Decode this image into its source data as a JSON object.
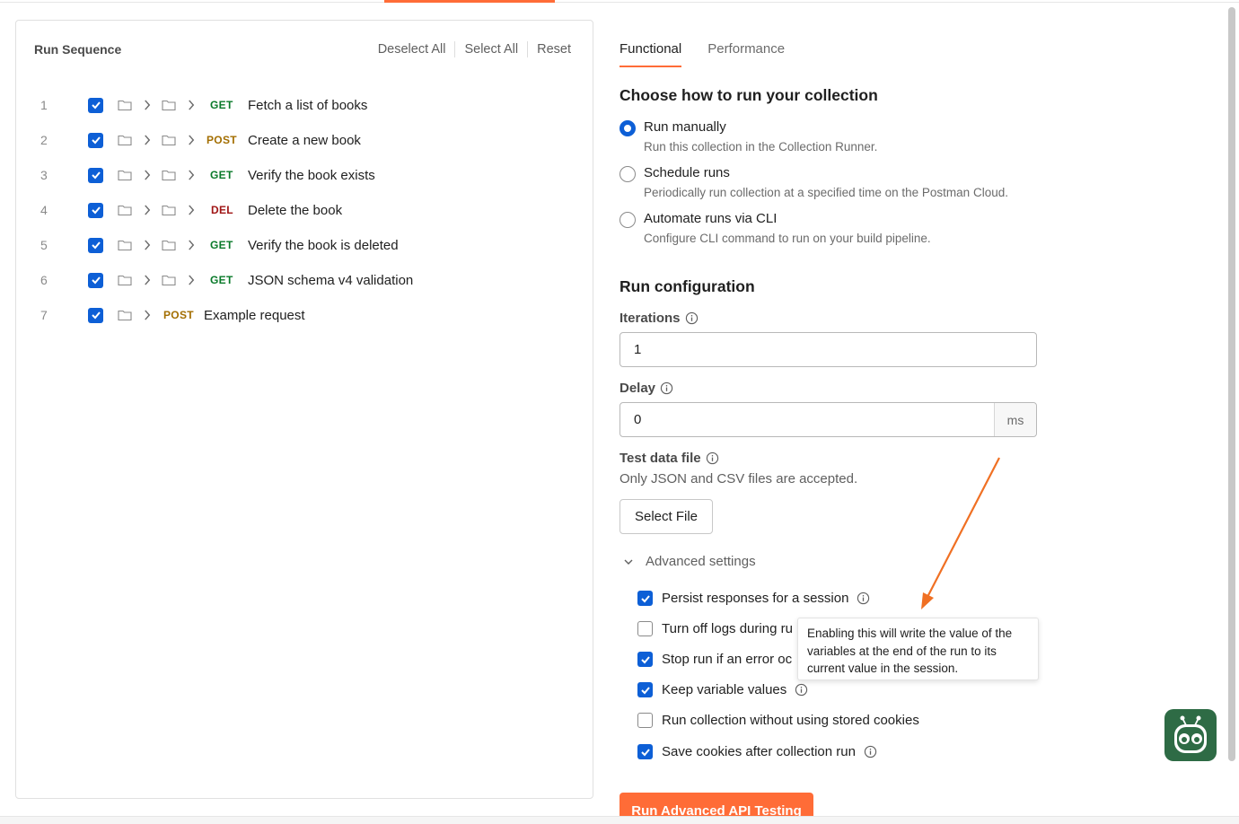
{
  "run_sequence": {
    "title": "Run Sequence",
    "actions": [
      "Deselect All",
      "Select All",
      "Reset"
    ],
    "items": [
      {
        "num": "1",
        "method": "GET",
        "name": "Fetch a list of books",
        "checked": true
      },
      {
        "num": "2",
        "method": "POST",
        "name": "Create a new book",
        "checked": true
      },
      {
        "num": "3",
        "method": "GET",
        "name": "Verify the book exists",
        "checked": true
      },
      {
        "num": "4",
        "method": "DEL",
        "name": "Delete the book",
        "checked": true
      },
      {
        "num": "5",
        "method": "GET",
        "name": "Verify the book is deleted",
        "checked": true
      },
      {
        "num": "6",
        "method": "GET",
        "name": "JSON schema v4 validation",
        "checked": true
      },
      {
        "num": "7",
        "method": "POST",
        "name": "Example request",
        "checked": true
      }
    ]
  },
  "tabs": [
    {
      "label": "Functional",
      "active": true
    },
    {
      "label": "Performance",
      "active": false
    }
  ],
  "run_mode": {
    "heading": "Choose how to run your collection",
    "options": [
      {
        "label": "Run manually",
        "description": "Run this collection in the Collection Runner.",
        "selected": true
      },
      {
        "label": "Schedule runs",
        "description": "Periodically run collection at a specified time on the Postman Cloud.",
        "selected": false
      },
      {
        "label": "Automate runs via CLI",
        "description": "Configure CLI command to run on your build pipeline.",
        "selected": false
      }
    ]
  },
  "config": {
    "heading": "Run configuration",
    "iterations_label": "Iterations",
    "iterations_value": "1",
    "delay_label": "Delay",
    "delay_value": "0",
    "delay_unit": "ms",
    "test_data_label": "Test data file",
    "test_data_hint": "Only JSON and CSV files are accepted.",
    "select_file_label": "Select File"
  },
  "advanced": {
    "label": "Advanced settings",
    "options": [
      {
        "label": "Persist responses for a session",
        "checked": true
      },
      {
        "label": "Turn off logs during ru",
        "checked": false
      },
      {
        "label": "Stop run if an error oc",
        "checked": true
      },
      {
        "label": "Keep variable values",
        "checked": true
      },
      {
        "label": "Run collection without using stored cookies",
        "checked": false
      },
      {
        "label": "Save cookies after collection run",
        "checked": true
      }
    ],
    "tooltip": "Enabling this will write the value of the variables at the end of the run to its current value in the session."
  },
  "run_button": "Run Advanced API Testing",
  "colors": {
    "accent": "#ff6c37",
    "checkbox": "#0d5fd6",
    "get": "#0a7a2a",
    "post": "#a36e00",
    "del": "#a01515"
  }
}
